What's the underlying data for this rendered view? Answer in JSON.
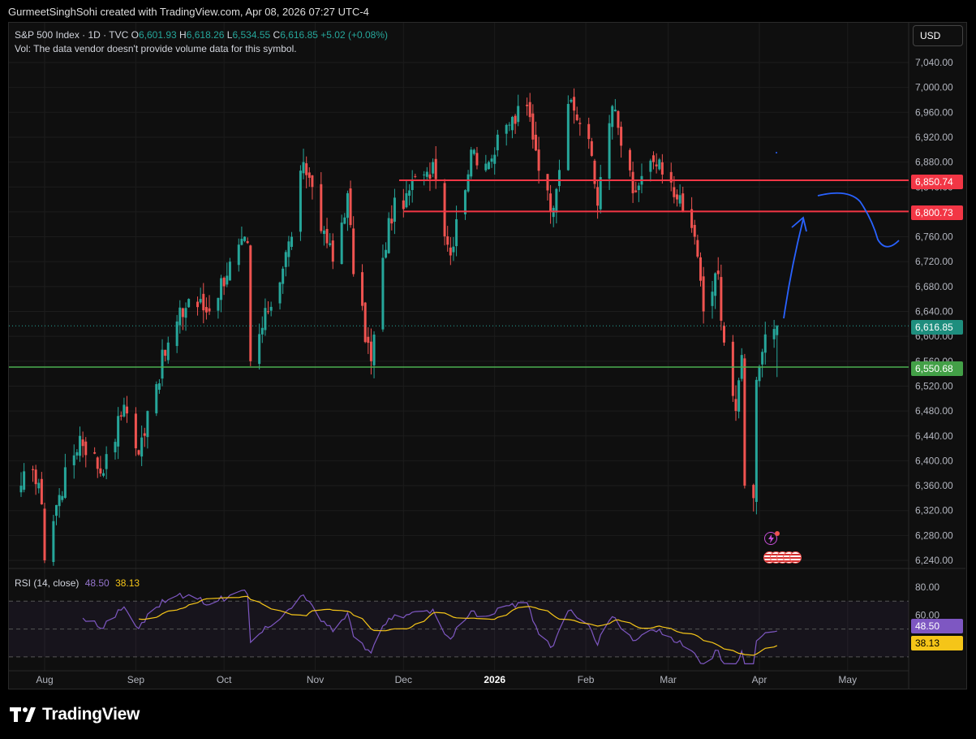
{
  "header": {
    "caption": "GurmeetSinghSohi created with TradingView.com, Apr 08, 2026 07:27 UTC-4"
  },
  "legend": {
    "symbol": "S&P 500 Index · 1D · TVC",
    "o_label": "O",
    "o_value": "6,601.93",
    "h_label": "H",
    "h_value": "6,618.26",
    "l_label": "L",
    "l_value": "6,534.55",
    "c_label": "C",
    "c_value": "6,616.85",
    "change": "+5.02 (+0.08%)",
    "volume_note": "Vol: The data vendor doesn't provide volume data for this symbol."
  },
  "currency_button": "USD",
  "price_axis": {
    "ticks": [
      "7,040.00",
      "7,000.00",
      "6,960.00",
      "6,920.00",
      "6,880.00",
      "6,840.00",
      "6,800.00",
      "6,760.00",
      "6,720.00",
      "6,680.00",
      "6,640.00",
      "6,600.00",
      "6,560.00",
      "6,520.00",
      "6,480.00",
      "6,440.00",
      "6,400.00",
      "6,360.00",
      "6,320.00",
      "6,280.00",
      "6,240.00"
    ]
  },
  "badges": {
    "resistance_upper": "6,850.74",
    "resistance_lower": "6,800.73",
    "last_price": "6,616.85",
    "support": "6,550.68"
  },
  "rsi": {
    "label": "RSI (14, close)",
    "rsi_value": "48.50",
    "ma_value": "38.13",
    "axis_ticks": [
      "80.00",
      "60.00"
    ]
  },
  "time_axis": {
    "labels": [
      "Aug",
      "Sep",
      "Oct",
      "Nov",
      "Dec",
      "2026",
      "Feb",
      "Mar",
      "Apr",
      "May"
    ]
  },
  "footer": {
    "brand": "TradingView"
  },
  "colors": {
    "up": "#26a69a",
    "down": "#ef5350",
    "resistance": "#f23645",
    "support": "#4caf50",
    "rsi_line": "#7e57c2",
    "rsi_ma": "#f5c518",
    "drawing": "#2962ff",
    "last_price": "#26a69a"
  },
  "chart_data": {
    "type": "candlestick",
    "ylim": [
      6220,
      7060
    ],
    "anchors": [
      {
        "date": "2025-07-24",
        "close": 6360
      },
      {
        "date": "2025-07-28",
        "close": 6385
      },
      {
        "date": "2025-07-31",
        "close": 6330
      },
      {
        "date": "2025-08-01",
        "close": 6240
      },
      {
        "date": "2025-08-06",
        "close": 6345
      },
      {
        "date": "2025-08-13",
        "close": 6440
      },
      {
        "date": "2025-08-21",
        "close": 6380
      },
      {
        "date": "2025-08-28",
        "close": 6490
      },
      {
        "date": "2025-09-02",
        "close": 6410
      },
      {
        "date": "2025-09-05",
        "close": 6480
      },
      {
        "date": "2025-09-12",
        "close": 6590
      },
      {
        "date": "2025-09-19",
        "close": 6660
      },
      {
        "date": "2025-09-26",
        "close": 6640
      },
      {
        "date": "2025-10-03",
        "close": 6720
      },
      {
        "date": "2025-10-09",
        "close": 6750
      },
      {
        "date": "2025-10-10",
        "close": 6560
      },
      {
        "date": "2025-10-16",
        "close": 6640
      },
      {
        "date": "2025-10-24",
        "close": 6760
      },
      {
        "date": "2025-10-28",
        "close": 6880
      },
      {
        "date": "2025-10-31",
        "close": 6840
      },
      {
        "date": "2025-11-04",
        "close": 6770
      },
      {
        "date": "2025-11-07",
        "close": 6720
      },
      {
        "date": "2025-11-12",
        "close": 6830
      },
      {
        "date": "2025-11-14",
        "close": 6700
      },
      {
        "date": "2025-11-20",
        "close": 6560
      },
      {
        "date": "2025-11-26",
        "close": 6790
      },
      {
        "date": "2025-12-02",
        "close": 6830
      },
      {
        "date": "2025-12-08",
        "close": 6860
      },
      {
        "date": "2025-12-11",
        "close": 6880
      },
      {
        "date": "2025-12-17",
        "close": 6730
      },
      {
        "date": "2025-12-24",
        "close": 6900
      },
      {
        "date": "2025-12-30",
        "close": 6880
      },
      {
        "date": "2026-01-06",
        "close": 6940
      },
      {
        "date": "2026-01-12",
        "close": 6970
      },
      {
        "date": "2026-01-20",
        "close": 6800
      },
      {
        "date": "2026-01-27",
        "close": 6980
      },
      {
        "date": "2026-02-03",
        "close": 6890
      },
      {
        "date": "2026-02-05",
        "close": 6810
      },
      {
        "date": "2026-02-10",
        "close": 6970
      },
      {
        "date": "2026-02-17",
        "close": 6830
      },
      {
        "date": "2026-02-24",
        "close": 6880
      },
      {
        "date": "2026-02-27",
        "close": 6860
      },
      {
        "date": "2026-03-04",
        "close": 6820
      },
      {
        "date": "2026-03-10",
        "close": 6760
      },
      {
        "date": "2026-03-13",
        "close": 6640
      },
      {
        "date": "2026-03-18",
        "close": 6700
      },
      {
        "date": "2026-03-20",
        "close": 6590
      },
      {
        "date": "2026-03-24",
        "close": 6480
      },
      {
        "date": "2026-03-26",
        "close": 6570
      },
      {
        "date": "2026-03-27",
        "close": 6360
      },
      {
        "date": "2026-03-30",
        "close": 6340
      },
      {
        "date": "2026-03-31",
        "close": 6530
      },
      {
        "date": "2026-04-02",
        "close": 6575
      },
      {
        "date": "2026-04-06",
        "close": 6611.83
      },
      {
        "date": "2026-04-07",
        "close": 6616.85
      }
    ],
    "last_bar": {
      "open": 6601.93,
      "high": 6618.26,
      "low": 6534.55,
      "close": 6616.85
    },
    "horizontal_levels": [
      {
        "price": 6850.74,
        "color": "resistance"
      },
      {
        "price": 6800.73,
        "color": "resistance"
      },
      {
        "price": 6550.68,
        "color": "support"
      }
    ],
    "rsi_ylim": [
      20,
      90
    ],
    "rsi_bands": [
      70,
      50,
      30
    ],
    "rsi_last": 48.5,
    "rsi_ma_last": 38.13
  }
}
